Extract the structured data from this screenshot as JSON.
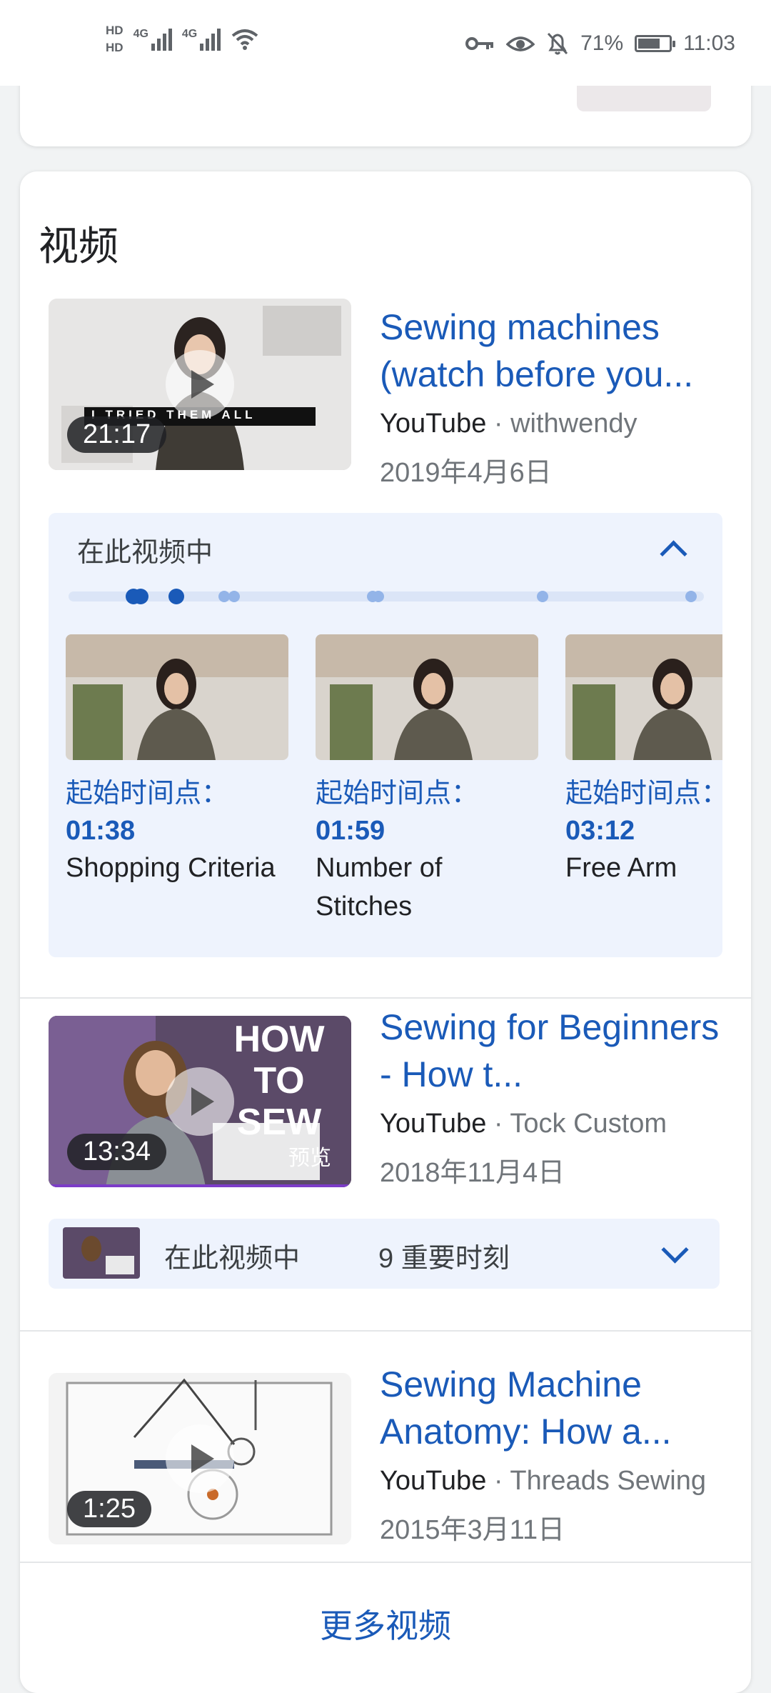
{
  "status_bar": {
    "hd1": "HD",
    "hd2": "HD",
    "net1": "4G",
    "net2": "4G",
    "battery_percent": "71%",
    "battery_level": 0.71,
    "time": "11:03"
  },
  "section": {
    "title": "视频"
  },
  "videos": [
    {
      "title": "Sewing machines (watch before you...",
      "source": "YouTube",
      "channel": "withwendy",
      "date": "2019年4月6日",
      "duration": "21:17",
      "overlay_text": "I TRIED THEM ALL"
    },
    {
      "title": "Sewing for Beginners - How t...",
      "source": "YouTube",
      "channel": "Tock Custom",
      "date": "2018年11月4日",
      "duration": "13:34",
      "overlay_text": "HOW TO SEW",
      "overlay_badge": "预览"
    },
    {
      "title": "Sewing Machine Anatomy: How a...",
      "source": "YouTube",
      "channel": "Threads Sewing",
      "date": "2015年3月11日",
      "duration": "1:25"
    }
  ],
  "chapters_expanded": {
    "header": "在此视频中",
    "start_label": "起始时间点：",
    "items": [
      {
        "time": "01:38",
        "name": "Shopping Criteria"
      },
      {
        "time": "01:59",
        "name": "Number of Stitches"
      },
      {
        "time": "03:12",
        "name": "Free Arm"
      }
    ]
  },
  "chapters_collapsed": {
    "label": "在此视频中",
    "count": "9 重要时刻"
  },
  "more_videos": "更多视频",
  "icons": {
    "key": "key-icon",
    "eye": "eye-icon",
    "bell_off": "bell-off-icon",
    "wifi": "wifi-icon",
    "expand_up": "chevron-up-icon",
    "expand_down": "chevron-down-icon",
    "play": "play-icon"
  },
  "colors": {
    "link": "#1a5ab8",
    "chapter_bg": "#eef3fd",
    "date": "#70757a"
  }
}
